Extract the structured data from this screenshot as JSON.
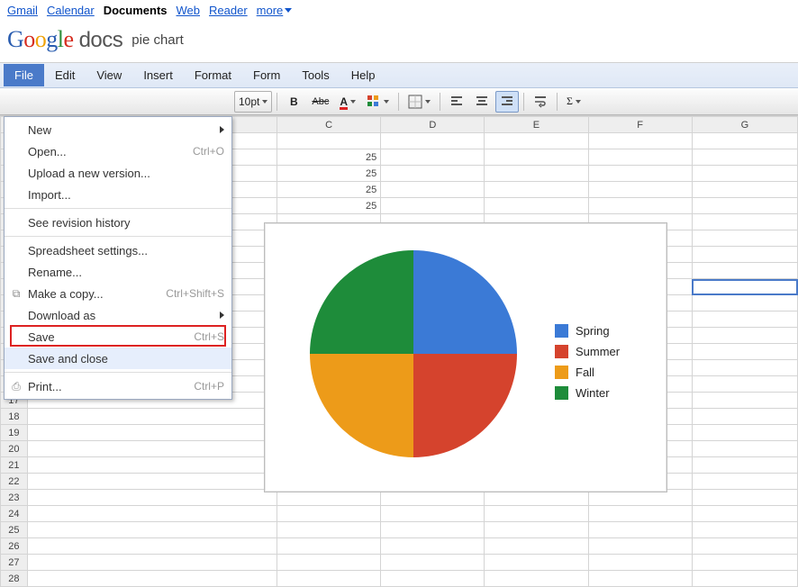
{
  "top_nav": {
    "gmail": "Gmail",
    "calendar": "Calendar",
    "documents": "Documents",
    "web": "Web",
    "reader": "Reader",
    "more": "more"
  },
  "logo": {
    "docs_label": "docs"
  },
  "doc_title": "pie chart",
  "menubar": [
    "File",
    "Edit",
    "View",
    "Insert",
    "Format",
    "Form",
    "Tools",
    "Help"
  ],
  "toolbar": {
    "font_size": "10pt"
  },
  "file_menu": {
    "new": "New",
    "open": "Open...",
    "open_sc": "Ctrl+O",
    "upload": "Upload a new version...",
    "import": "Import...",
    "revision": "See revision history",
    "settings": "Spreadsheet settings...",
    "rename": "Rename...",
    "copy": "Make a copy...",
    "copy_sc": "Ctrl+Shift+S",
    "download": "Download as",
    "save": "Save",
    "save_sc": "Ctrl+S",
    "save_close": "Save and close",
    "print": "Print...",
    "print_sc": "Ctrl+P"
  },
  "columns": [
    "C",
    "D",
    "E",
    "F",
    "G"
  ],
  "row_start": 17,
  "row_end": 28,
  "data_cells": {
    "c2": "25",
    "c3": "25",
    "c4": "25",
    "c5": "25"
  },
  "chart_data": {
    "type": "pie",
    "categories": [
      "Spring",
      "Summer",
      "Fall",
      "Winter"
    ],
    "values": [
      25,
      25,
      25,
      25
    ],
    "colors": [
      "#3b7ad6",
      "#d5432d",
      "#ed9b19",
      "#1e8c3a"
    ],
    "title": "",
    "legend_position": "right"
  }
}
